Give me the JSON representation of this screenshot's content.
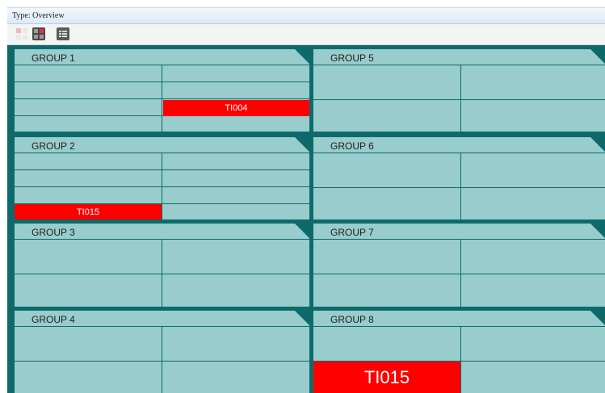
{
  "window": {
    "title": "Type: Overview"
  },
  "toolbar": {
    "buttons": [
      {
        "icon": "grid-red-disabled-icon"
      },
      {
        "icon": "grid-red-active-icon"
      },
      {
        "icon": "list-view-icon"
      }
    ]
  },
  "colors": {
    "panel": "#99cccc",
    "border": "#0e6a6a",
    "alarm": "#ff0000"
  },
  "groups": [
    {
      "title": "GROUP 1",
      "alarm": "TI004"
    },
    {
      "title": "GROUP 2",
      "alarm": "TI015"
    },
    {
      "title": "GROUP 3"
    },
    {
      "title": "GROUP 4"
    },
    {
      "title": "GROUP 5"
    },
    {
      "title": "GROUP 6"
    },
    {
      "title": "GROUP 7"
    },
    {
      "title": "GROUP 8",
      "alarm": "TI015"
    }
  ]
}
